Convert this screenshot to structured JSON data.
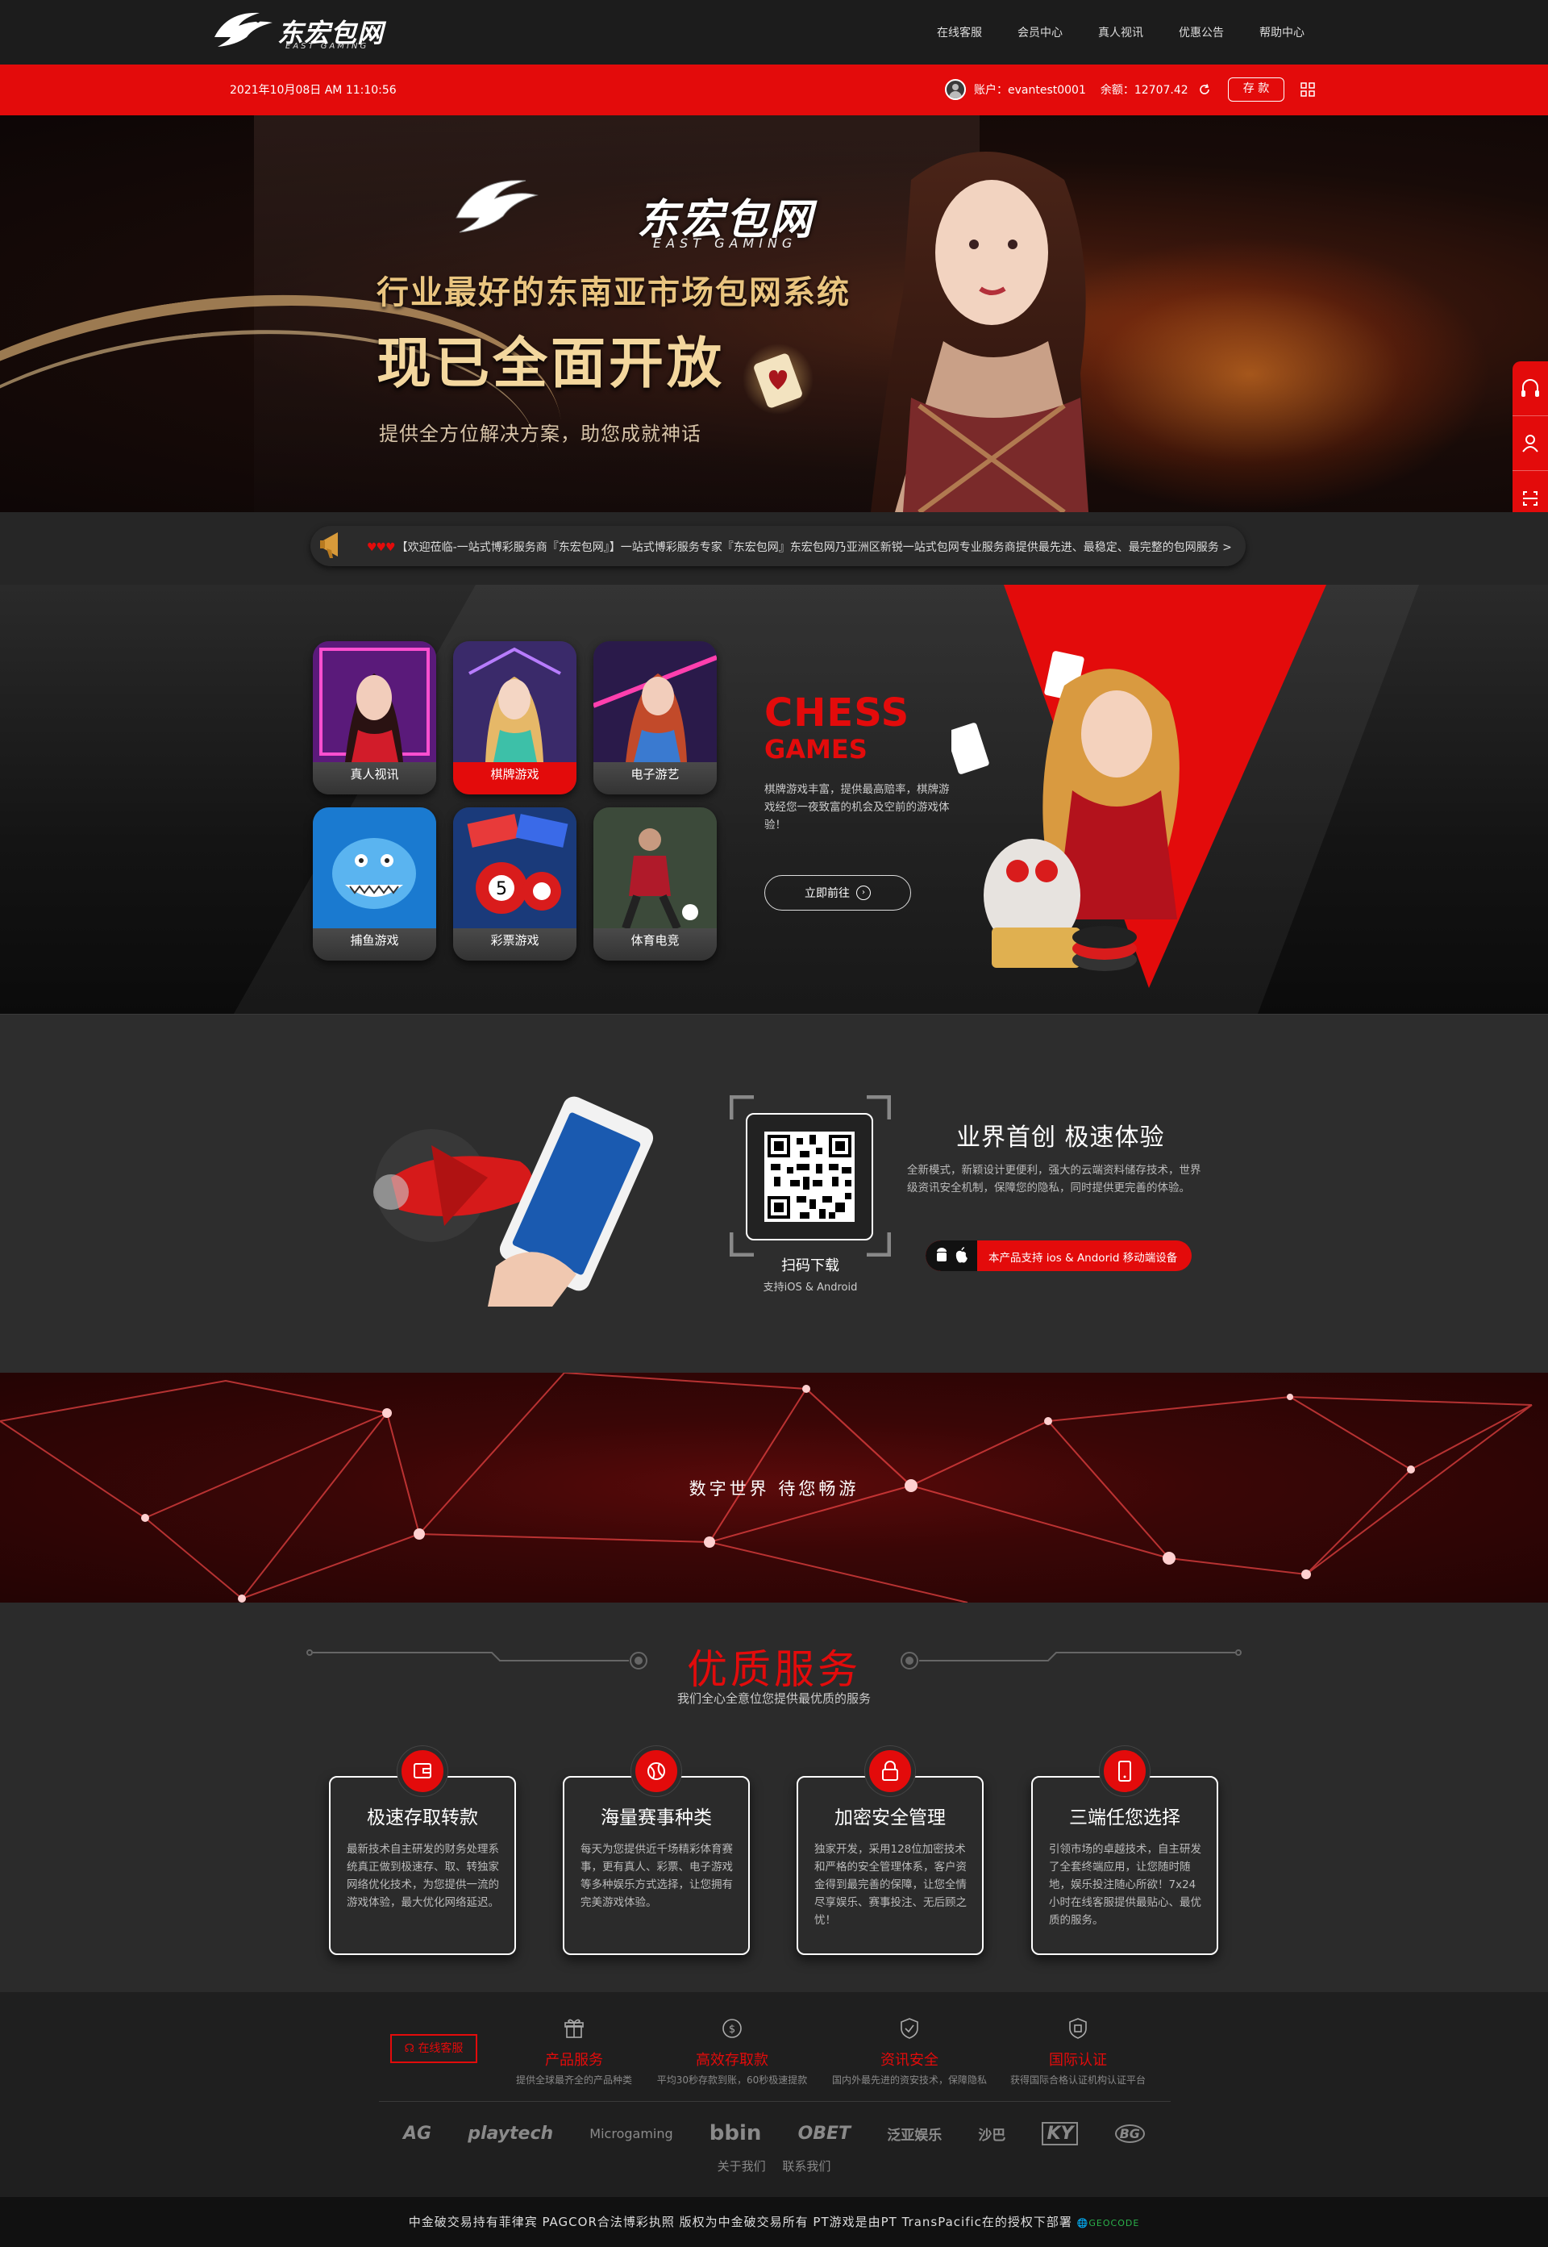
{
  "header": {
    "logo_text": "东宏包网",
    "logo_sub": "EAST GAMING",
    "nav": [
      "在线客服",
      "会员中心",
      "真人视讯",
      "优惠公告",
      "帮助中心"
    ]
  },
  "topbar": {
    "datetime": "2021年10月08日 AM 11:10:56",
    "account": "账户：evantest0001",
    "balance": "余额：12707.42",
    "deposit_label": "存 款"
  },
  "banner": {
    "logo_text": "东宏包网",
    "logo_sub": "EAST GAMING",
    "headline1": "行业最好的东南亚市场包网系统",
    "headline2": "现已全面开放",
    "subline": "提供全方位解决方案，助您成就神话"
  },
  "side_tools": [
    "headset-icon",
    "user-icon",
    "scan-icon"
  ],
  "marquee": {
    "hearts": "♥♥♥",
    "text": "【欢迎莅临-一站式博彩服务商『东宏包网』】一站式博彩服务专家『东宏包网』东宏包网乃亚洲区新锐一站式包网专业服务商提供最先进、最稳定、最完整的包网服务 >"
  },
  "games": {
    "cards": [
      {
        "label": "真人视讯"
      },
      {
        "label": "棋牌游戏"
      },
      {
        "label": "电子游艺"
      },
      {
        "label": "捕鱼游戏"
      },
      {
        "label": "彩票游戏"
      },
      {
        "label": "体育电竞"
      }
    ],
    "active_index": 1,
    "title1": "CHESS",
    "title2": "GAMES",
    "description": "棋牌游戏丰富，提供最高赔率，棋牌游戏经您一夜致富的机会及空前的游戏体验！",
    "go_label": "立即前往"
  },
  "download": {
    "scan_label": "扫码下载",
    "scan_sub": "支持iOS & Android",
    "title": "业界首创 极速体验",
    "description": "全新模式，新颖设计更便利，强大的云端资料储存技术，世界级资讯安全机制，保障您的隐私，同时提供更完善的体验。",
    "badge_text": "本产品支持 ios & Andorid 移动端设备"
  },
  "network_text": "数字世界 待您畅游",
  "services": {
    "title": "优质服务",
    "subtitle": "我们全心全意位您提供最优质的服务",
    "cards": [
      {
        "icon": "wallet-icon",
        "title": "极速存取转款",
        "desc": "最新技术自主研发的财务处理系统真正做到极速存、取、转独家网络优化技术，为您提供一流的游戏体验，最大优化网络延迟。"
      },
      {
        "icon": "ball-icon",
        "title": "海量赛事种类",
        "desc": "每天为您提供近千场精彩体育赛事，更有真人、彩票、电子游戏等多种娱乐方式选择，让您拥有完美游戏体验。"
      },
      {
        "icon": "lock-icon",
        "title": "加密安全管理",
        "desc": "独家开发，采用128位加密技术和严格的安全管理体系，客户资金得到最完善的保障，让您全情尽享娱乐、赛事投注、无后顾之忧！"
      },
      {
        "icon": "phone-icon",
        "title": "三端任您选择",
        "desc": "引领市场的卓越技术，自主研发了全套终端应用，让您随时随地，娱乐投注随心所欲！7x24小时在线客服提供最贴心、最优质的服务。"
      }
    ]
  },
  "footer": {
    "live_chat": "在线客服",
    "features": [
      {
        "icon": "gift-icon",
        "title": "产品服务",
        "desc": "提供全球最齐全的产品种类"
      },
      {
        "icon": "dollar-icon",
        "title": "高效存取款",
        "desc": "平均30秒存款到账，60秒极速提款"
      },
      {
        "icon": "shield-check-icon",
        "title": "资讯安全",
        "desc": "国内外最先进的资安技术，保障隐私"
      },
      {
        "icon": "badge-icon",
        "title": "国际认证",
        "desc": "获得国际合格认证机构认证平台"
      }
    ],
    "partners": [
      "AG",
      "playtech",
      "Microgaming",
      "bbin",
      "OBET",
      "泛亚娱乐",
      "沙巴",
      "KY",
      "BG"
    ],
    "links": [
      "关于我们",
      "联系我们"
    ],
    "copyright": "中金破交易持有菲律宾 PAGCOR合法博彩执照 版权为中金破交易所有 PT游戏是由PT TransPacific在的授权下部署",
    "copyright_tail": "GEOCODE"
  },
  "colors": {
    "accent": "#e30b0b",
    "dark": "#222222"
  }
}
